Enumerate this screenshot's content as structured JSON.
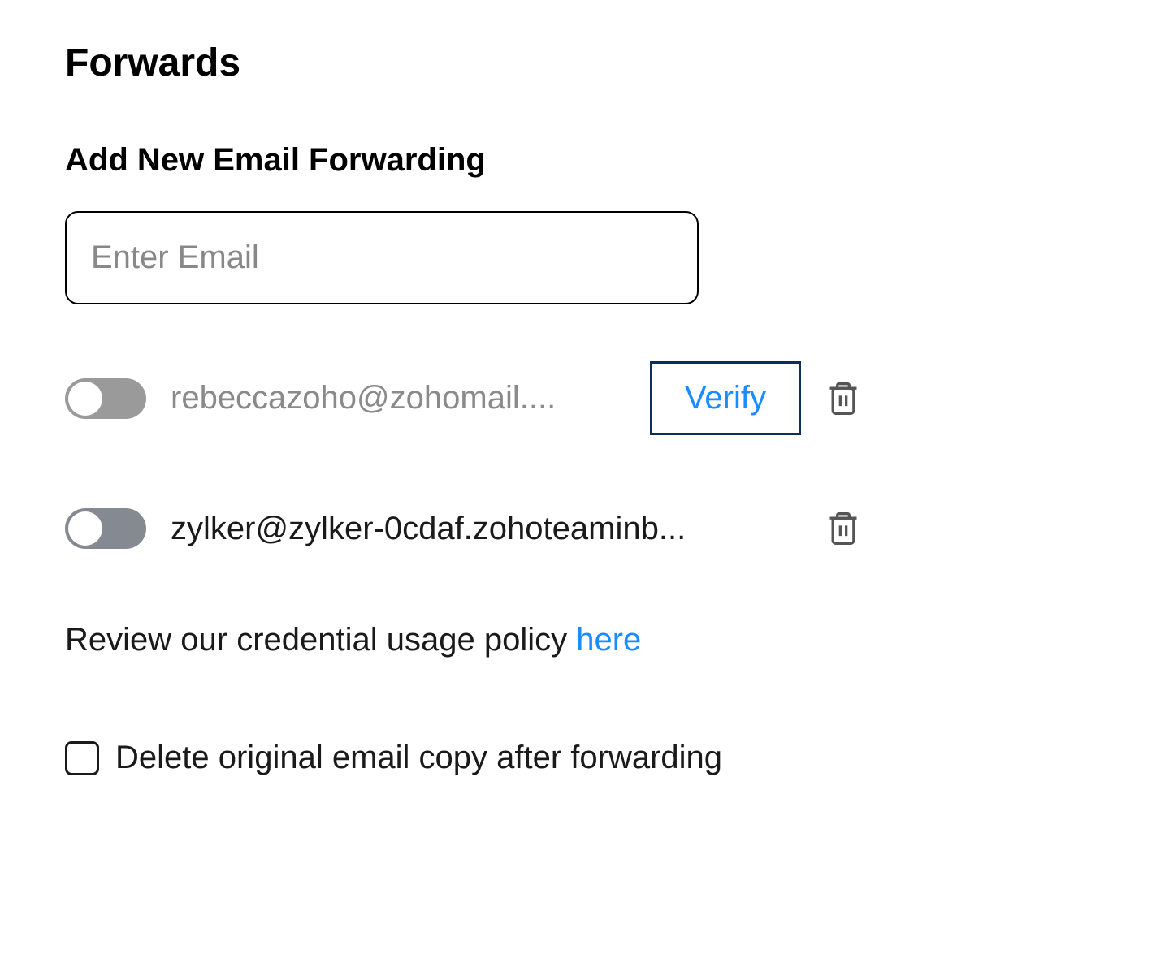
{
  "header": {
    "title": "Forwards"
  },
  "addForwarding": {
    "label": "Add New Email Forwarding",
    "placeholder": "Enter Email",
    "value": ""
  },
  "forwards": [
    {
      "email": "rebeccazoho@zohomail....",
      "enabled": false,
      "needsVerify": true,
      "verifyLabel": "Verify"
    },
    {
      "email": "zylker@zylker-0cdaf.zohoteaminb...",
      "enabled": false,
      "needsVerify": false
    }
  ],
  "policy": {
    "text": "Review our credential usage policy ",
    "linkText": "here"
  },
  "deleteOption": {
    "label": "Delete original email copy after forwarding",
    "checked": false
  }
}
